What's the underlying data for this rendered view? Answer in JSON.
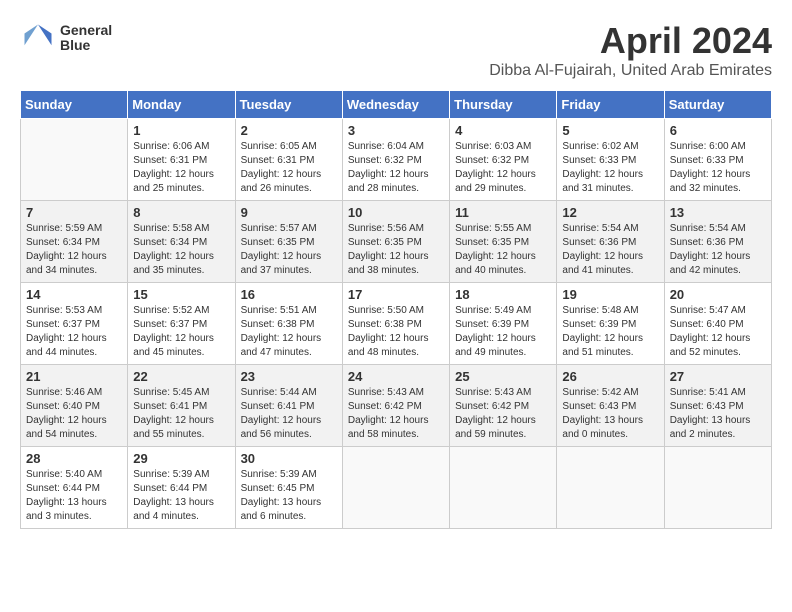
{
  "header": {
    "logo_line1": "General",
    "logo_line2": "Blue",
    "month": "April 2024",
    "location": "Dibba Al-Fujairah, United Arab Emirates"
  },
  "weekdays": [
    "Sunday",
    "Monday",
    "Tuesday",
    "Wednesday",
    "Thursday",
    "Friday",
    "Saturday"
  ],
  "weeks": [
    [
      {
        "day": "",
        "info": ""
      },
      {
        "day": "1",
        "info": "Sunrise: 6:06 AM\nSunset: 6:31 PM\nDaylight: 12 hours\nand 25 minutes."
      },
      {
        "day": "2",
        "info": "Sunrise: 6:05 AM\nSunset: 6:31 PM\nDaylight: 12 hours\nand 26 minutes."
      },
      {
        "day": "3",
        "info": "Sunrise: 6:04 AM\nSunset: 6:32 PM\nDaylight: 12 hours\nand 28 minutes."
      },
      {
        "day": "4",
        "info": "Sunrise: 6:03 AM\nSunset: 6:32 PM\nDaylight: 12 hours\nand 29 minutes."
      },
      {
        "day": "5",
        "info": "Sunrise: 6:02 AM\nSunset: 6:33 PM\nDaylight: 12 hours\nand 31 minutes."
      },
      {
        "day": "6",
        "info": "Sunrise: 6:00 AM\nSunset: 6:33 PM\nDaylight: 12 hours\nand 32 minutes."
      }
    ],
    [
      {
        "day": "7",
        "info": "Sunrise: 5:59 AM\nSunset: 6:34 PM\nDaylight: 12 hours\nand 34 minutes."
      },
      {
        "day": "8",
        "info": "Sunrise: 5:58 AM\nSunset: 6:34 PM\nDaylight: 12 hours\nand 35 minutes."
      },
      {
        "day": "9",
        "info": "Sunrise: 5:57 AM\nSunset: 6:35 PM\nDaylight: 12 hours\nand 37 minutes."
      },
      {
        "day": "10",
        "info": "Sunrise: 5:56 AM\nSunset: 6:35 PM\nDaylight: 12 hours\nand 38 minutes."
      },
      {
        "day": "11",
        "info": "Sunrise: 5:55 AM\nSunset: 6:35 PM\nDaylight: 12 hours\nand 40 minutes."
      },
      {
        "day": "12",
        "info": "Sunrise: 5:54 AM\nSunset: 6:36 PM\nDaylight: 12 hours\nand 41 minutes."
      },
      {
        "day": "13",
        "info": "Sunrise: 5:54 AM\nSunset: 6:36 PM\nDaylight: 12 hours\nand 42 minutes."
      }
    ],
    [
      {
        "day": "14",
        "info": "Sunrise: 5:53 AM\nSunset: 6:37 PM\nDaylight: 12 hours\nand 44 minutes."
      },
      {
        "day": "15",
        "info": "Sunrise: 5:52 AM\nSunset: 6:37 PM\nDaylight: 12 hours\nand 45 minutes."
      },
      {
        "day": "16",
        "info": "Sunrise: 5:51 AM\nSunset: 6:38 PM\nDaylight: 12 hours\nand 47 minutes."
      },
      {
        "day": "17",
        "info": "Sunrise: 5:50 AM\nSunset: 6:38 PM\nDaylight: 12 hours\nand 48 minutes."
      },
      {
        "day": "18",
        "info": "Sunrise: 5:49 AM\nSunset: 6:39 PM\nDaylight: 12 hours\nand 49 minutes."
      },
      {
        "day": "19",
        "info": "Sunrise: 5:48 AM\nSunset: 6:39 PM\nDaylight: 12 hours\nand 51 minutes."
      },
      {
        "day": "20",
        "info": "Sunrise: 5:47 AM\nSunset: 6:40 PM\nDaylight: 12 hours\nand 52 minutes."
      }
    ],
    [
      {
        "day": "21",
        "info": "Sunrise: 5:46 AM\nSunset: 6:40 PM\nDaylight: 12 hours\nand 54 minutes."
      },
      {
        "day": "22",
        "info": "Sunrise: 5:45 AM\nSunset: 6:41 PM\nDaylight: 12 hours\nand 55 minutes."
      },
      {
        "day": "23",
        "info": "Sunrise: 5:44 AM\nSunset: 6:41 PM\nDaylight: 12 hours\nand 56 minutes."
      },
      {
        "day": "24",
        "info": "Sunrise: 5:43 AM\nSunset: 6:42 PM\nDaylight: 12 hours\nand 58 minutes."
      },
      {
        "day": "25",
        "info": "Sunrise: 5:43 AM\nSunset: 6:42 PM\nDaylight: 12 hours\nand 59 minutes."
      },
      {
        "day": "26",
        "info": "Sunrise: 5:42 AM\nSunset: 6:43 PM\nDaylight: 13 hours\nand 0 minutes."
      },
      {
        "day": "27",
        "info": "Sunrise: 5:41 AM\nSunset: 6:43 PM\nDaylight: 13 hours\nand 2 minutes."
      }
    ],
    [
      {
        "day": "28",
        "info": "Sunrise: 5:40 AM\nSunset: 6:44 PM\nDaylight: 13 hours\nand 3 minutes."
      },
      {
        "day": "29",
        "info": "Sunrise: 5:39 AM\nSunset: 6:44 PM\nDaylight: 13 hours\nand 4 minutes."
      },
      {
        "day": "30",
        "info": "Sunrise: 5:39 AM\nSunset: 6:45 PM\nDaylight: 13 hours\nand 6 minutes."
      },
      {
        "day": "",
        "info": ""
      },
      {
        "day": "",
        "info": ""
      },
      {
        "day": "",
        "info": ""
      },
      {
        "day": "",
        "info": ""
      }
    ]
  ]
}
